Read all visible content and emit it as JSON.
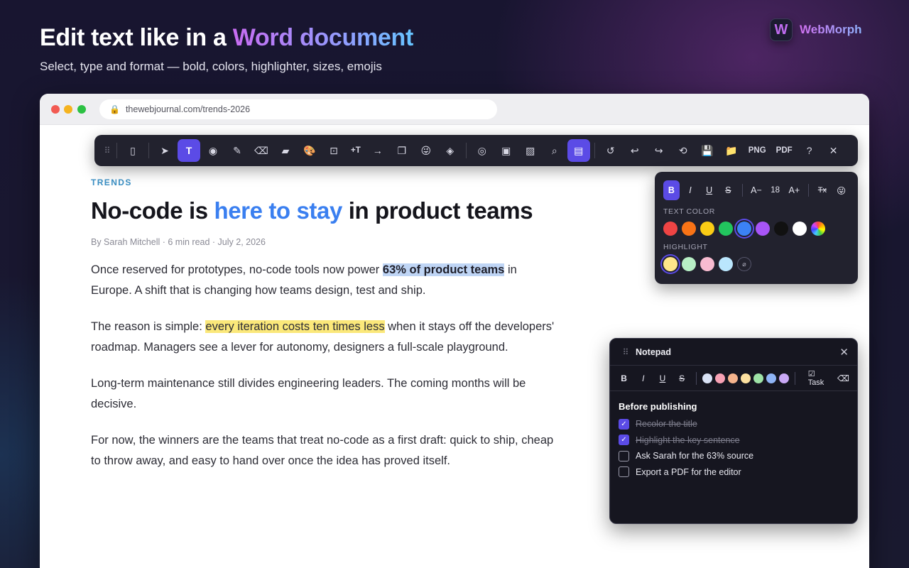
{
  "hero": {
    "title_lead": "Edit text like in a ",
    "title_highlight": "Word document",
    "subtitle": "Select, type and format — bold, colors, highlighter, sizes, emojis"
  },
  "brand": {
    "logo_letter": "W",
    "name": "WebMorph"
  },
  "browser": {
    "url": "thewebjournal.com/trends-2026"
  },
  "article": {
    "kicker": "TRENDS",
    "headline_pre": "No-code is ",
    "headline_highlight": "here to stay",
    "headline_post": " in product teams",
    "byline": "By Sarah Mitchell · 6 min read · July 2, 2026",
    "p1_pre": "Once reserved for prototypes, no-code tools now power ",
    "p1_highlight": "63% of product teams",
    "p1_post": " in Europe. A shift that is changing how teams design, test and ship.",
    "p2_pre": "The reason is simple: ",
    "p2_highlight": "every iteration costs ten times less",
    "p2_post": " when it stays off the developers' roadmap. Managers see a lever for autonomy, designers a full-scale playground.",
    "p3": "Long-term maintenance still divides engineering leaders. The coming months will be decisive.",
    "p4": "For now, the winners are the teams that treat no-code as a first draft: quick to ship, cheap to throw away, and easy to hand over once the idea has proved itself."
  },
  "toolbar": {
    "grip": "⠿",
    "sidebar": "▯",
    "select": "➤",
    "text": "T",
    "hide": "◉",
    "pen": "✎",
    "eraser": "⌫",
    "marker": "▰",
    "palette": "🎨",
    "capture": "⊡",
    "add_text": "+T",
    "arrow": "→",
    "shapes": "❐",
    "emoji": "😜",
    "layers": "◈",
    "target": "◎",
    "crop": "▣",
    "image": "▨",
    "zoom": "⌕",
    "notes": "▤",
    "refresh": "↺",
    "undo": "↩",
    "redo": "↪",
    "history": "⟲",
    "save": "💾",
    "folder": "📁",
    "png_label": "PNG",
    "pdf_label": "PDF",
    "help": "?",
    "close": "✕"
  },
  "format": {
    "bold": "B",
    "italic": "I",
    "underline": "U",
    "strike": "S",
    "smaller": "A−",
    "size": "18",
    "bigger": "A+",
    "clear": "Tx",
    "emoji": "😜",
    "text_color_label": "TEXT COLOR",
    "highlight_label": "HIGHLIGHT",
    "no_highlight": "⌀",
    "text_colors": [
      "#ef4444",
      "#f97316",
      "#facc15",
      "#22c55e",
      "#3b82f6",
      "#a855f7",
      "#111111",
      "#ffffff"
    ],
    "selected_text_color": "#3b82f6",
    "highlight_colors": [
      "#fde68a",
      "#b7efc5",
      "#f8bbd0",
      "#bae6fd"
    ],
    "selected_highlight": "#fde68a"
  },
  "notepad": {
    "grip": "⠿",
    "title": "Notepad",
    "close": "✕",
    "bold": "B",
    "italic": "I",
    "underline": "U",
    "strike": "S",
    "colors": [
      "#d9e2f5",
      "#f7a1b4",
      "#f5b38c",
      "#fde1a0",
      "#9ee3a6",
      "#8fb4f5",
      "#c9a8f5"
    ],
    "task_label": "☑ Task",
    "erase": "⌫",
    "heading": "Before publishing",
    "items": [
      {
        "label": "Recolor the title",
        "checked": true
      },
      {
        "label": "Highlight the key sentence",
        "checked": true
      },
      {
        "label": "Ask Sarah for the 63% source",
        "checked": false
      },
      {
        "label": "Export a PDF for the editor",
        "checked": false
      }
    ],
    "check_mark": "✓"
  }
}
